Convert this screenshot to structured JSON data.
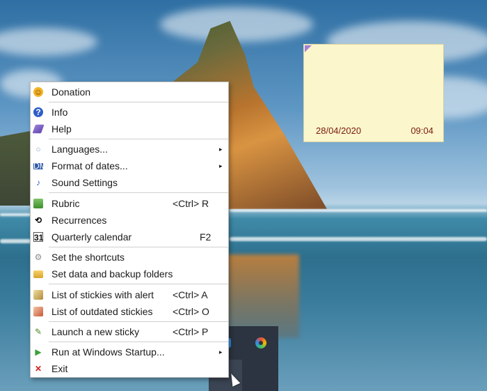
{
  "sticky": {
    "date": "28/04/2020",
    "time": "09:04"
  },
  "menu": {
    "items": [
      {
        "label": "Donation",
        "icon": "smiley-icon"
      },
      {
        "label": "Info",
        "icon": "info-icon"
      },
      {
        "label": "Help",
        "icon": "book-icon"
      },
      {
        "label": "Languages...",
        "icon": "speech-bubble-icon",
        "submenu": true
      },
      {
        "label": "Format of dates...",
        "icon": "date-format-icon",
        "submenu": true
      },
      {
        "label": "Sound Settings",
        "icon": "music-note-icon"
      },
      {
        "label": "Rubric",
        "icon": "green-book-icon",
        "shortcut": "<Ctrl> R"
      },
      {
        "label": "Recurrences",
        "icon": "repeat-icon"
      },
      {
        "label": "Quarterly calendar",
        "icon": "calendar-icon",
        "shortcut": "F2",
        "icon_text": "31"
      },
      {
        "label": "Set the shortcuts",
        "icon": "gear-icon"
      },
      {
        "label": "Set data and backup folders",
        "icon": "folder-icon"
      },
      {
        "label": "List of stickies with alert",
        "icon": "alert-list-icon",
        "shortcut": "<Ctrl> A"
      },
      {
        "label": "List of outdated stickies",
        "icon": "outdated-list-icon",
        "shortcut": "<Ctrl> O"
      },
      {
        "label": "Launch a new sticky",
        "icon": "new-sticky-icon",
        "shortcut": "<Ctrl> P"
      },
      {
        "label": "Run at Windows Startup...",
        "icon": "play-icon",
        "submenu": true
      },
      {
        "label": "Exit",
        "icon": "close-icon"
      }
    ]
  },
  "colors": {
    "sticky_bg": "#fbf6cc",
    "sticky_text": "#7a1a0c",
    "menu_bg": "#ffffff"
  }
}
